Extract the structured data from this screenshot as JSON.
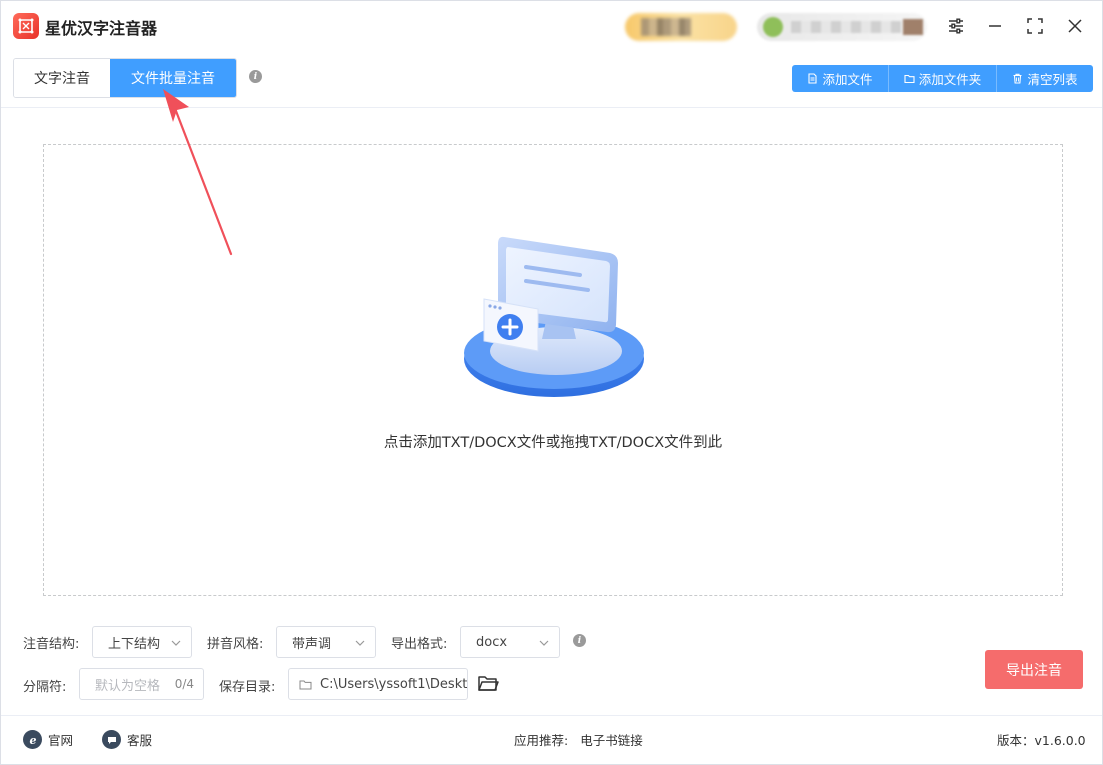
{
  "app": {
    "title": "星优汉字注音器"
  },
  "tabs": [
    {
      "label": "文字注音",
      "active": false
    },
    {
      "label": "文件批量注音",
      "active": true
    }
  ],
  "toolbar": {
    "add_file": "添加文件",
    "add_folder": "添加文件夹",
    "clear_list": "清空列表"
  },
  "drop_zone": {
    "hint": "点击添加TXT/DOCX文件或拖拽TXT/DOCX文件到此"
  },
  "options": {
    "structure_label": "注音结构:",
    "structure_value": "上下结构",
    "style_label": "拼音风格:",
    "style_value": "带声调",
    "format_label": "导出格式:",
    "format_value": "docx",
    "separator_label": "分隔符:",
    "separator_placeholder": "默认为空格",
    "separator_count": "0/4",
    "save_dir_label": "保存目录:",
    "save_dir_value": "C:\\Users\\yssoft1\\Deskt"
  },
  "export_button": "导出注音",
  "footer": {
    "website": "官网",
    "support": "客服",
    "recommend_label": "应用推荐:",
    "recommend_link": "电子书链接",
    "version": "版本：v1.6.0.0"
  },
  "colors": {
    "primary": "#409eff",
    "danger": "#f56c6c",
    "annotation_arrow": "#f0505a"
  },
  "icons": {
    "logo": "app-logo-icon",
    "settings": "sliders-icon",
    "minimize": "minimize-icon",
    "maximize": "maximize-icon",
    "close": "close-icon",
    "info": "info-icon",
    "folder": "folder-icon",
    "file": "file-icon",
    "trash": "trash-icon"
  }
}
